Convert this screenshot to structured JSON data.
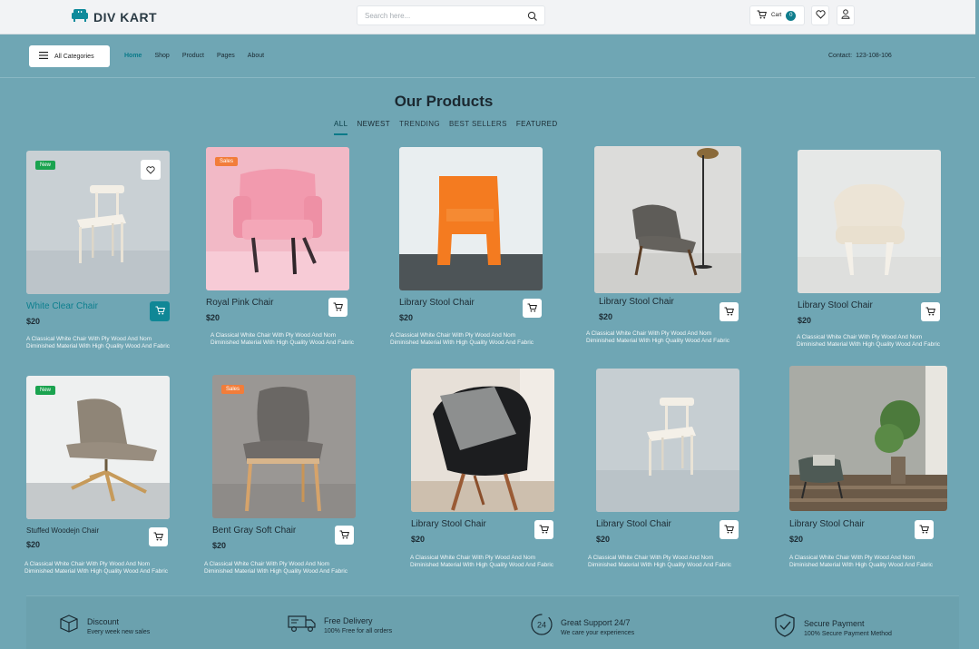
{
  "header": {
    "logo_text": "DIV KART",
    "search_placeholder": "Search here...",
    "cart_label": "Cart",
    "cart_count": "0",
    "icons": [
      "sofa-icon",
      "search-icon",
      "cart-icon",
      "heart-icon",
      "user-icon"
    ]
  },
  "nav": {
    "categories_label": "All Categories",
    "links": [
      "Home",
      "Shop",
      "Product",
      "Pages",
      "About"
    ],
    "active_link": "Home",
    "contact_label": "Contact:",
    "contact_phone": "123-108-106"
  },
  "products_section": {
    "title": "Our Products",
    "filters": [
      "ALL",
      "NEWEST",
      "TRENDING",
      "BEST SELLERS",
      "FEATURED"
    ],
    "active_filter": "ALL"
  },
  "products": [
    {
      "title": "White Clear Chair",
      "price": "$20",
      "badge": "New",
      "desc": "A Classical White Chair With Ply Wood And Nom Diminished  Material With   High Quality Wood And Fabric"
    },
    {
      "title": "Royal Pink Chair",
      "price": "$20",
      "badge": "Sales",
      "desc": "A Classical White Chair With Ply Wood And Nom Diminished  Material With   High Quality Wood And Fabric"
    },
    {
      "title": "Library Stool Chair",
      "price": "$20",
      "badge": "",
      "desc": "A Classical White Chair With Ply Wood And Nom Diminished  Material With   High Quality Wood And Fabric"
    },
    {
      "title": "Library Stool Chair",
      "price": "$20",
      "badge": "",
      "desc": "A Classical White Chair With Ply Wood And Nom Diminished  Material With   High Quality Wood And Fabric"
    },
    {
      "title": "Library Stool Chair",
      "price": "$20",
      "badge": "",
      "desc": "A Classical White Chair With Ply Wood And Nom Diminished  Material With   High Quality Wood And Fabric"
    },
    {
      "title": "Stuffed Woodejn Chair",
      "price": "$20",
      "badge": "New",
      "desc": "A Classical White Chair With Ply Wood And Nom Diminished  Material With   High Quality Wood And Fabric"
    },
    {
      "title": "Bent Gray Soft Chair",
      "price": "$20",
      "badge": "Sales",
      "desc": "A Classical White Chair With Ply Wood And Nom Diminished  Material With   High Quality Wood And Fabric"
    },
    {
      "title": "Library Stool Chair",
      "price": "$20",
      "badge": "",
      "desc": "A Classical White Chair With Ply Wood And Nom Diminished  Material With   High Quality Wood And Fabric"
    },
    {
      "title": "Library Stool Chair",
      "price": "$20",
      "badge": "",
      "desc": "A Classical White Chair With Ply Wood And Nom Diminished  Material With   High Quality Wood And Fabric"
    },
    {
      "title": "Library Stool Chair",
      "price": "$20",
      "badge": "",
      "desc": "A Classical White Chair With Ply Wood And Nom Diminished  Material With   High Quality Wood And Fabric"
    }
  ],
  "features": [
    {
      "title": "Discount",
      "subtitle": "Every week new sales",
      "icon": "box-icon"
    },
    {
      "title": "Free Delivery",
      "subtitle": "100% Free for all orders",
      "icon": "truck-icon"
    },
    {
      "title": "Great Support 24/7",
      "subtitle": "We care your experiences",
      "icon": "support-24-icon"
    },
    {
      "title": "Secure Payment",
      "subtitle": "100% Secure Payment Method",
      "icon": "shield-check-icon"
    }
  ],
  "colors": {
    "accent": "#0a7a89",
    "background": "#6fa6b4",
    "new_badge": "#1aa34f",
    "sale_badge": "#f27d3a"
  }
}
